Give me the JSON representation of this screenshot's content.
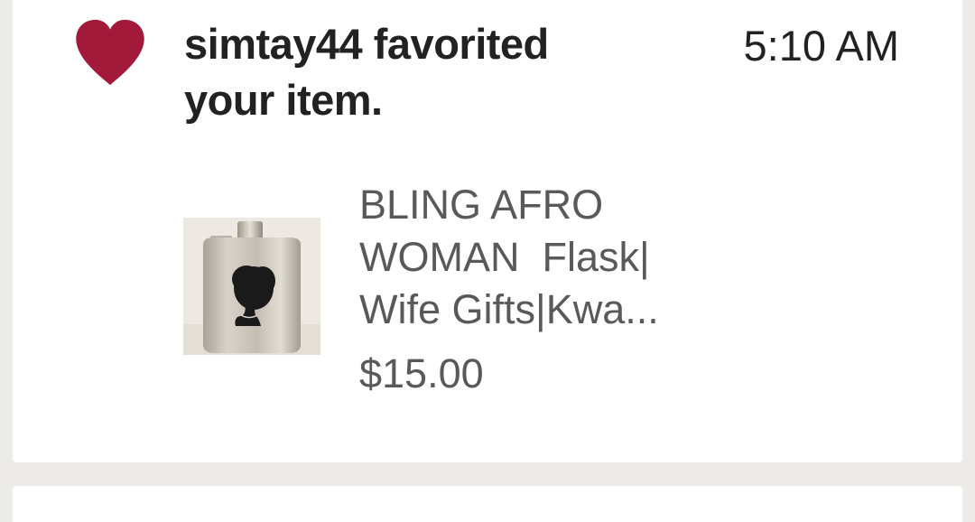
{
  "notification": {
    "icon": "heart-icon",
    "icon_color": "#a3193a",
    "username": "simtay44",
    "action": "favorited",
    "object": "your item.",
    "time": "5:10 AM"
  },
  "item": {
    "thumbnail_icon": "flask-silhouette-image",
    "title_lines": [
      "BLING AFRO",
      "WOMAN  Flask|",
      "Wife Gifts|Kwa..."
    ],
    "price": "$15.00"
  }
}
